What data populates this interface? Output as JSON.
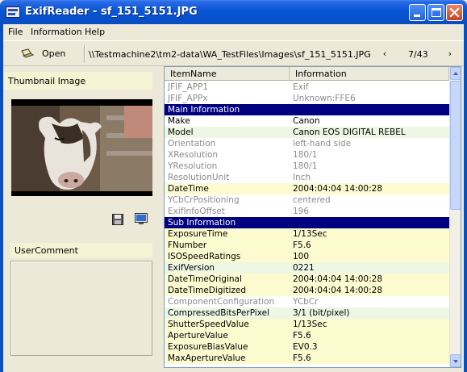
{
  "window": {
    "title": "ExifReader - sf_151_5151.JPG"
  },
  "menu": {
    "items": [
      "File",
      "Information",
      "Help"
    ]
  },
  "toolbar": {
    "open_label": "Open",
    "path": "\\\\Testmachine2\\tm2-data\\WA_TestFiles\\Images\\sf_151_5151.JPG",
    "prev_glyph": "‹",
    "counter": "7/43",
    "next_glyph": "›"
  },
  "left_panel": {
    "thumbnail_header": "Thumbnail Image",
    "user_comment_header": "UserComment",
    "icons": [
      "save-icon",
      "monitor-icon"
    ]
  },
  "list": {
    "columns": [
      "ItemName",
      "Information"
    ],
    "rows": [
      {
        "name": "JFIF_APP1",
        "value": "Exif",
        "style": "gray"
      },
      {
        "name": "JFIF_APPx",
        "value": "Unknown:FFE6",
        "style": "gray"
      },
      {
        "name": "Main Information",
        "value": "",
        "style": "section"
      },
      {
        "name": "Make",
        "value": "Canon",
        "style": "white"
      },
      {
        "name": "Model",
        "value": "Canon EOS DIGITAL REBEL",
        "style": "green"
      },
      {
        "name": "Orientation",
        "value": "left-hand side",
        "style": "gray"
      },
      {
        "name": "XResolution",
        "value": "180/1",
        "style": "gray"
      },
      {
        "name": "YResolution",
        "value": "180/1",
        "style": "gray"
      },
      {
        "name": "ResolutionUnit",
        "value": "Inch",
        "style": "gray"
      },
      {
        "name": "DateTime",
        "value": "2004:04:04 14:00:28",
        "style": "yellow"
      },
      {
        "name": "YCbCrPositioning",
        "value": "centered",
        "style": "gray"
      },
      {
        "name": "ExifInfoOffset",
        "value": "196",
        "style": "gray"
      },
      {
        "name": "Sub Information",
        "value": "",
        "style": "section"
      },
      {
        "name": "ExposureTime",
        "value": "1/13Sec",
        "style": "yellow"
      },
      {
        "name": "FNumber",
        "value": "F5.6",
        "style": "yellow"
      },
      {
        "name": "ISOSpeedRatings",
        "value": "100",
        "style": "yellow"
      },
      {
        "name": "ExifVersion",
        "value": "0221",
        "style": "green"
      },
      {
        "name": "DateTimeOriginal",
        "value": "2004:04:04 14:00:28",
        "style": "yellow"
      },
      {
        "name": "DateTimeDigitized",
        "value": "2004:04:04 14:00:28",
        "style": "yellow"
      },
      {
        "name": "ComponentConfiguration",
        "value": "YCbCr",
        "style": "gray"
      },
      {
        "name": "CompressedBitsPerPixel",
        "value": "3/1 (bit/pixel)",
        "style": "green"
      },
      {
        "name": "ShutterSpeedValue",
        "value": "1/13Sec",
        "style": "yellow"
      },
      {
        "name": "ApertureValue",
        "value": "F5.6",
        "style": "yellow"
      },
      {
        "name": "ExposureBiasValue",
        "value": "EV0.3",
        "style": "yellow"
      },
      {
        "name": "MaxApertureValue",
        "value": "F5.6",
        "style": "yellow"
      }
    ]
  },
  "colors": {
    "section_bg": "#000080",
    "highlight_yellow": "#fcfbd0",
    "highlight_green": "#eef7e4",
    "muted_text": "#8b8b8b",
    "titlebar_blue": "#0a58d8"
  }
}
